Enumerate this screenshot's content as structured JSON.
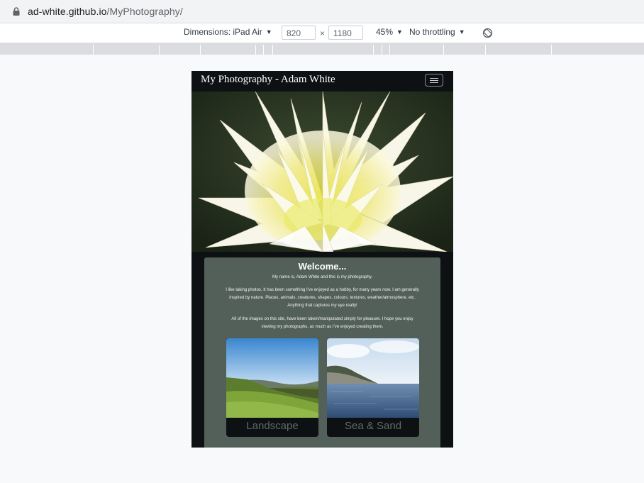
{
  "browser": {
    "url_host": "ad-white.github.io",
    "url_path": "/MyPhotography/"
  },
  "device_toolbar": {
    "dimensions_label": "Dimensions: iPad Air",
    "width_value": "820",
    "height_value": "1180",
    "zoom_label": "45%",
    "throttling_label": "No throttling"
  },
  "site": {
    "brand": "My Photography - Adam White",
    "welcome_title": "Welcome...",
    "para1": "My name is, Adam White and this is my photography.",
    "para2": "I like taking photos. It has been something I've enjoyed as a hobby, for many years now. I am generally inspired by nature. Places, animals, creatures, shapes, colours, textures, weather/atmosphere, etc. Anything that captures my eye really!",
    "para3": "All of the images on this site, have been taken/manipulated simply for pleasure. I hope you enjoy viewing my photographs, as much as I've enjoyed creating them.",
    "tiles": [
      {
        "caption": "Landscape"
      },
      {
        "caption": "Sea & Sand"
      }
    ]
  },
  "colors": {
    "navbar": "#0e1114",
    "card": "#526059",
    "caption": "#5e6a66"
  }
}
